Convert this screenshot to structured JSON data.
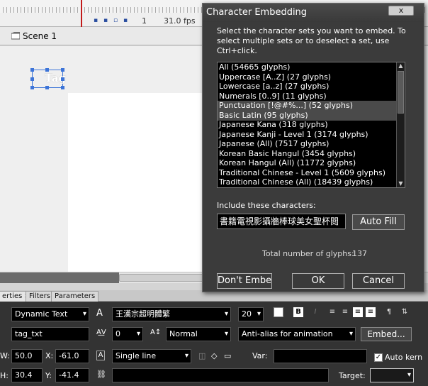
{
  "timeline": {
    "frame": "1",
    "fps": "31.0 fps"
  },
  "scene": {
    "label": "Scene 1"
  },
  "stage": {
    "text_field": "Tag"
  },
  "panel_tabs": [
    {
      "label": "erties"
    },
    {
      "label": "Filters"
    },
    {
      "label": "Parameters"
    }
  ],
  "properties": {
    "text_type": "Dynamic Text",
    "font": "王漢宗超明體繁",
    "font_size": "20",
    "instance_name": "tag_txt",
    "letter_spacing": "0",
    "char_position": "Normal",
    "anti_alias": "Anti-alias for animation",
    "embed_label": "Embed...",
    "w_label": "W:",
    "w_value": "50.0",
    "x_label": "X:",
    "x_value": "-61.0",
    "h_label": "H:",
    "h_value": "30.4",
    "y_label": "Y:",
    "y_value": "-41.4",
    "line_type": "Single line",
    "var_label": "Var:",
    "var_value": "",
    "autokern_label": "Auto kern",
    "autokern_checked": true,
    "target_label": "Target:",
    "target_value": ""
  },
  "dialog": {
    "title": "Character Embedding",
    "close_label": "x",
    "instructions": "Select the character sets you want to embed. To select multiple sets or to deselect a set, use Ctrl+click.",
    "charsets": [
      {
        "label": "All  (54665 glyphs)",
        "selected": false
      },
      {
        "label": "Uppercase [A..Z]  (27 glyphs)",
        "selected": false
      },
      {
        "label": "Lowercase [a..z]  (27 glyphs)",
        "selected": false
      },
      {
        "label": "Numerals [0..9]  (11 glyphs)",
        "selected": false
      },
      {
        "label": "Punctuation [!@#%...]  (52 glyphs)",
        "selected": true
      },
      {
        "label": "Basic Latin  (95 glyphs)",
        "selected": true
      },
      {
        "label": "Japanese Kana  (318 glyphs)",
        "selected": false
      },
      {
        "label": "Japanese Kanji - Level 1 (3174 glyphs)",
        "selected": false
      },
      {
        "label": "Japanese (All)  (7517 glyphs)",
        "selected": false
      },
      {
        "label": "Korean Basic Hangul (3454 glyphs)",
        "selected": false
      },
      {
        "label": "Korean Hangul (All) (11772 glyphs)",
        "selected": false
      },
      {
        "label": "Traditional Chinese - Level 1 (5609 glyphs)",
        "selected": false
      },
      {
        "label": "Traditional Chinese (All)  (18439 glyphs)",
        "selected": false
      }
    ],
    "include_label": "Include these characters:",
    "include_value": "書籍電視影攝牆棒球美女聖杯閲",
    "autofill_label": "Auto Fill",
    "total_label": "Total number of glyphs:",
    "total_value": "137",
    "dont_embed_label": "Don't Embed",
    "ok_label": "OK",
    "cancel_label": "Cancel"
  },
  "colors": {
    "dialog_bg": "#3b3b3b",
    "panel_bg": "#333333",
    "list_selected": "#4a4a4a",
    "selection_blue": "#3c74d8",
    "playhead": "#c21a1a"
  }
}
